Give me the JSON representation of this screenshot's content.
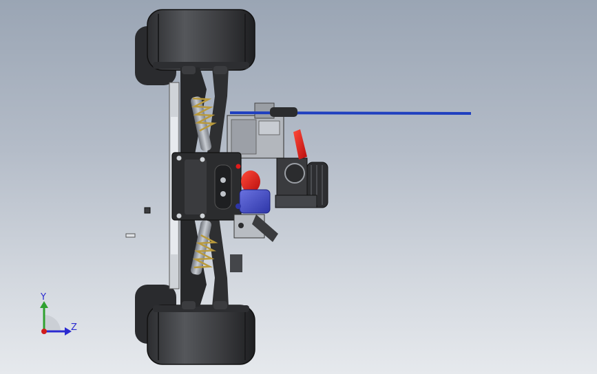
{
  "viewport": {
    "background_top": "#9aa5b4",
    "background_bottom": "#e6e9ed"
  },
  "model": {
    "tire_color": "#3a3b3e",
    "chassis_color": "#2b2c2e",
    "part_gray": "#8c9096",
    "spring_color": "#b99a3c",
    "accent_red": "#e21b1b",
    "accent_blue": "#4d55c8",
    "antenna_color": "#1f3fbf"
  },
  "triad": {
    "y_label": "Y",
    "z_label": "Z",
    "y_axis_color": "#2fa12f",
    "z_axis_color": "#2a2ad0",
    "x_axis_color": "#d11c1c"
  }
}
